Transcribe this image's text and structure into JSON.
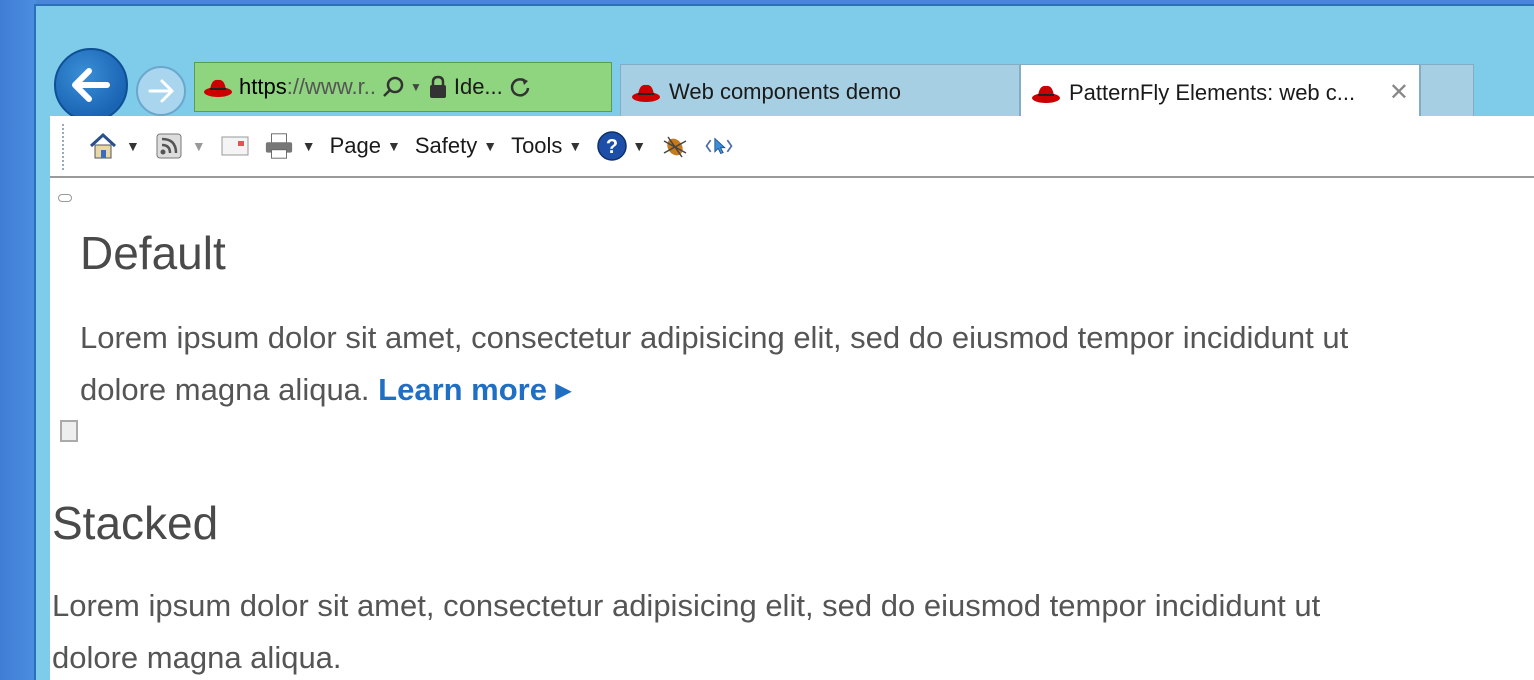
{
  "browser": {
    "address_url_prefix": "https",
    "address_url_rest": "://www.r..",
    "identity_label": "Ide...",
    "tabs": [
      {
        "label": "Web components demo",
        "active": false
      },
      {
        "label": "PatternFly Elements: web c...",
        "active": true
      }
    ],
    "close_glyph": "✕"
  },
  "commandbar": {
    "page_label": "Page",
    "safety_label": "Safety",
    "tools_label": "Tools"
  },
  "content": {
    "section1": {
      "title": "Default",
      "text_line1": "Lorem ipsum dolor sit amet, consectetur adipisicing elit, sed do eiusmod tempor incididunt ut",
      "text_line2": "dolore magna aliqua. ",
      "link_label": "Learn more"
    },
    "section2": {
      "title": "Stacked",
      "text_line1": "Lorem ipsum dolor sit amet, consectetur adipisicing elit, sed do eiusmod tempor incididunt ut",
      "text_line2": "dolore magna aliqua."
    }
  },
  "colors": {
    "accent_blue": "#1f6fc4",
    "address_green": "#8fd47e",
    "frame_blue": "#7ecbea",
    "redhat_red": "#cc0000"
  }
}
